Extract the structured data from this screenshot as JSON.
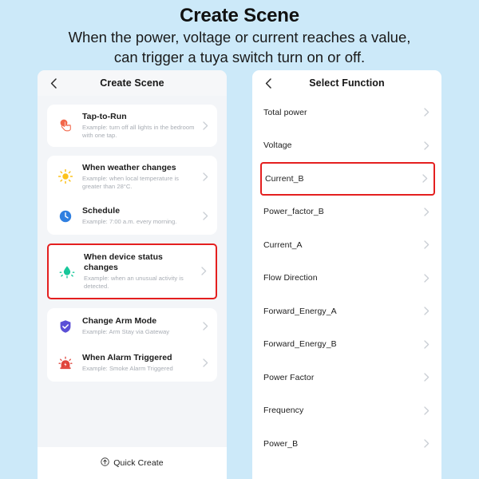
{
  "header": {
    "title": "Create Scene",
    "subtitle_line1": "When the power, voltage or current reaches a value,",
    "subtitle_line2": "can trigger a tuya switch turn on or off."
  },
  "colors": {
    "page_background": "#cce9f9",
    "panel_background": "#f3f5f8",
    "card_background": "#ffffff",
    "highlight": "#e41f1f",
    "title_text": "#1b1b1b",
    "desc_text": "#a8adb4",
    "chevron": "#c9ced4",
    "icon_tap_to_run": "#f2674a",
    "icon_weather": "#fcc21b",
    "icon_schedule": "#2f7fe0",
    "icon_device_status": "#16c79a",
    "icon_arm_mode": "#5b4fd6",
    "icon_alarm": "#e0453c"
  },
  "left_panel": {
    "back_icon": "chevron-left-icon",
    "title": "Create Scene",
    "cards": [
      {
        "icon": "tap-hand-icon",
        "title": "Tap-to-Run",
        "desc": "Example: turn off all lights in the bedroom with one tap.",
        "highlighted": false
      },
      {
        "icon": "sun-icon",
        "title": "When weather changes",
        "desc": "Example: when local temperature is greater than 28°C.",
        "highlighted": false
      },
      {
        "icon": "clock-icon",
        "title": "Schedule",
        "desc": "Example: 7:00 a.m. every morning.",
        "highlighted": false
      },
      {
        "icon": "motion-sensor-icon",
        "title": "When device status changes",
        "desc": "Example: when an unusual activity is detected.",
        "highlighted": true
      },
      {
        "icon": "shield-check-icon",
        "title": "Change Arm Mode",
        "desc": "Example: Arm Stay via Gateway",
        "highlighted": false
      },
      {
        "icon": "siren-icon",
        "title": "When Alarm Triggered",
        "desc": "Example: Smoke Alarm Triggered",
        "highlighted": false
      }
    ],
    "footer": {
      "icon": "circle-arrow-up-icon",
      "label": "Quick Create"
    }
  },
  "right_panel": {
    "back_icon": "chevron-left-icon",
    "title": "Select Function",
    "functions": [
      {
        "label": "Total power",
        "highlighted": false
      },
      {
        "label": "Voltage",
        "highlighted": false
      },
      {
        "label": "Current_B",
        "highlighted": true
      },
      {
        "label": "Power_factor_B",
        "highlighted": false
      },
      {
        "label": "Current_A",
        "highlighted": false
      },
      {
        "label": "Flow Direction",
        "highlighted": false
      },
      {
        "label": "Forward_Energy_A",
        "highlighted": false
      },
      {
        "label": "Forward_Energy_B",
        "highlighted": false
      },
      {
        "label": "Power Factor",
        "highlighted": false
      },
      {
        "label": "Frequency",
        "highlighted": false
      },
      {
        "label": "Power_B",
        "highlighted": false
      }
    ]
  }
}
